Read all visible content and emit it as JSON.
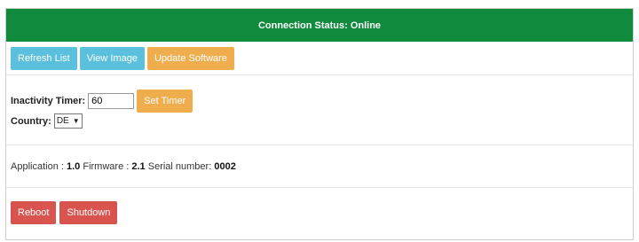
{
  "status": {
    "text": "Connection Status: Online"
  },
  "toolbar": {
    "refresh_label": "Refresh List",
    "view_label": "View Image",
    "update_label": "Update Software"
  },
  "settings": {
    "timer_label": "Inactivity Timer:",
    "timer_value": "60",
    "set_timer_label": "Set Timer",
    "country_label": "Country:",
    "country_value": "DE"
  },
  "info": {
    "app_label": "Application :",
    "app_value": "1.0",
    "firmware_label": "Firmware :",
    "firmware_value": "2.1",
    "serial_label": "Serial number:",
    "serial_value": "0002"
  },
  "actions": {
    "reboot_label": "Reboot",
    "shutdown_label": "Shutdown"
  },
  "colors": {
    "status_bg": "#108a3c",
    "info_button": "#5bc0de",
    "warning_button": "#f0ad4e",
    "danger_button": "#d9534f"
  }
}
